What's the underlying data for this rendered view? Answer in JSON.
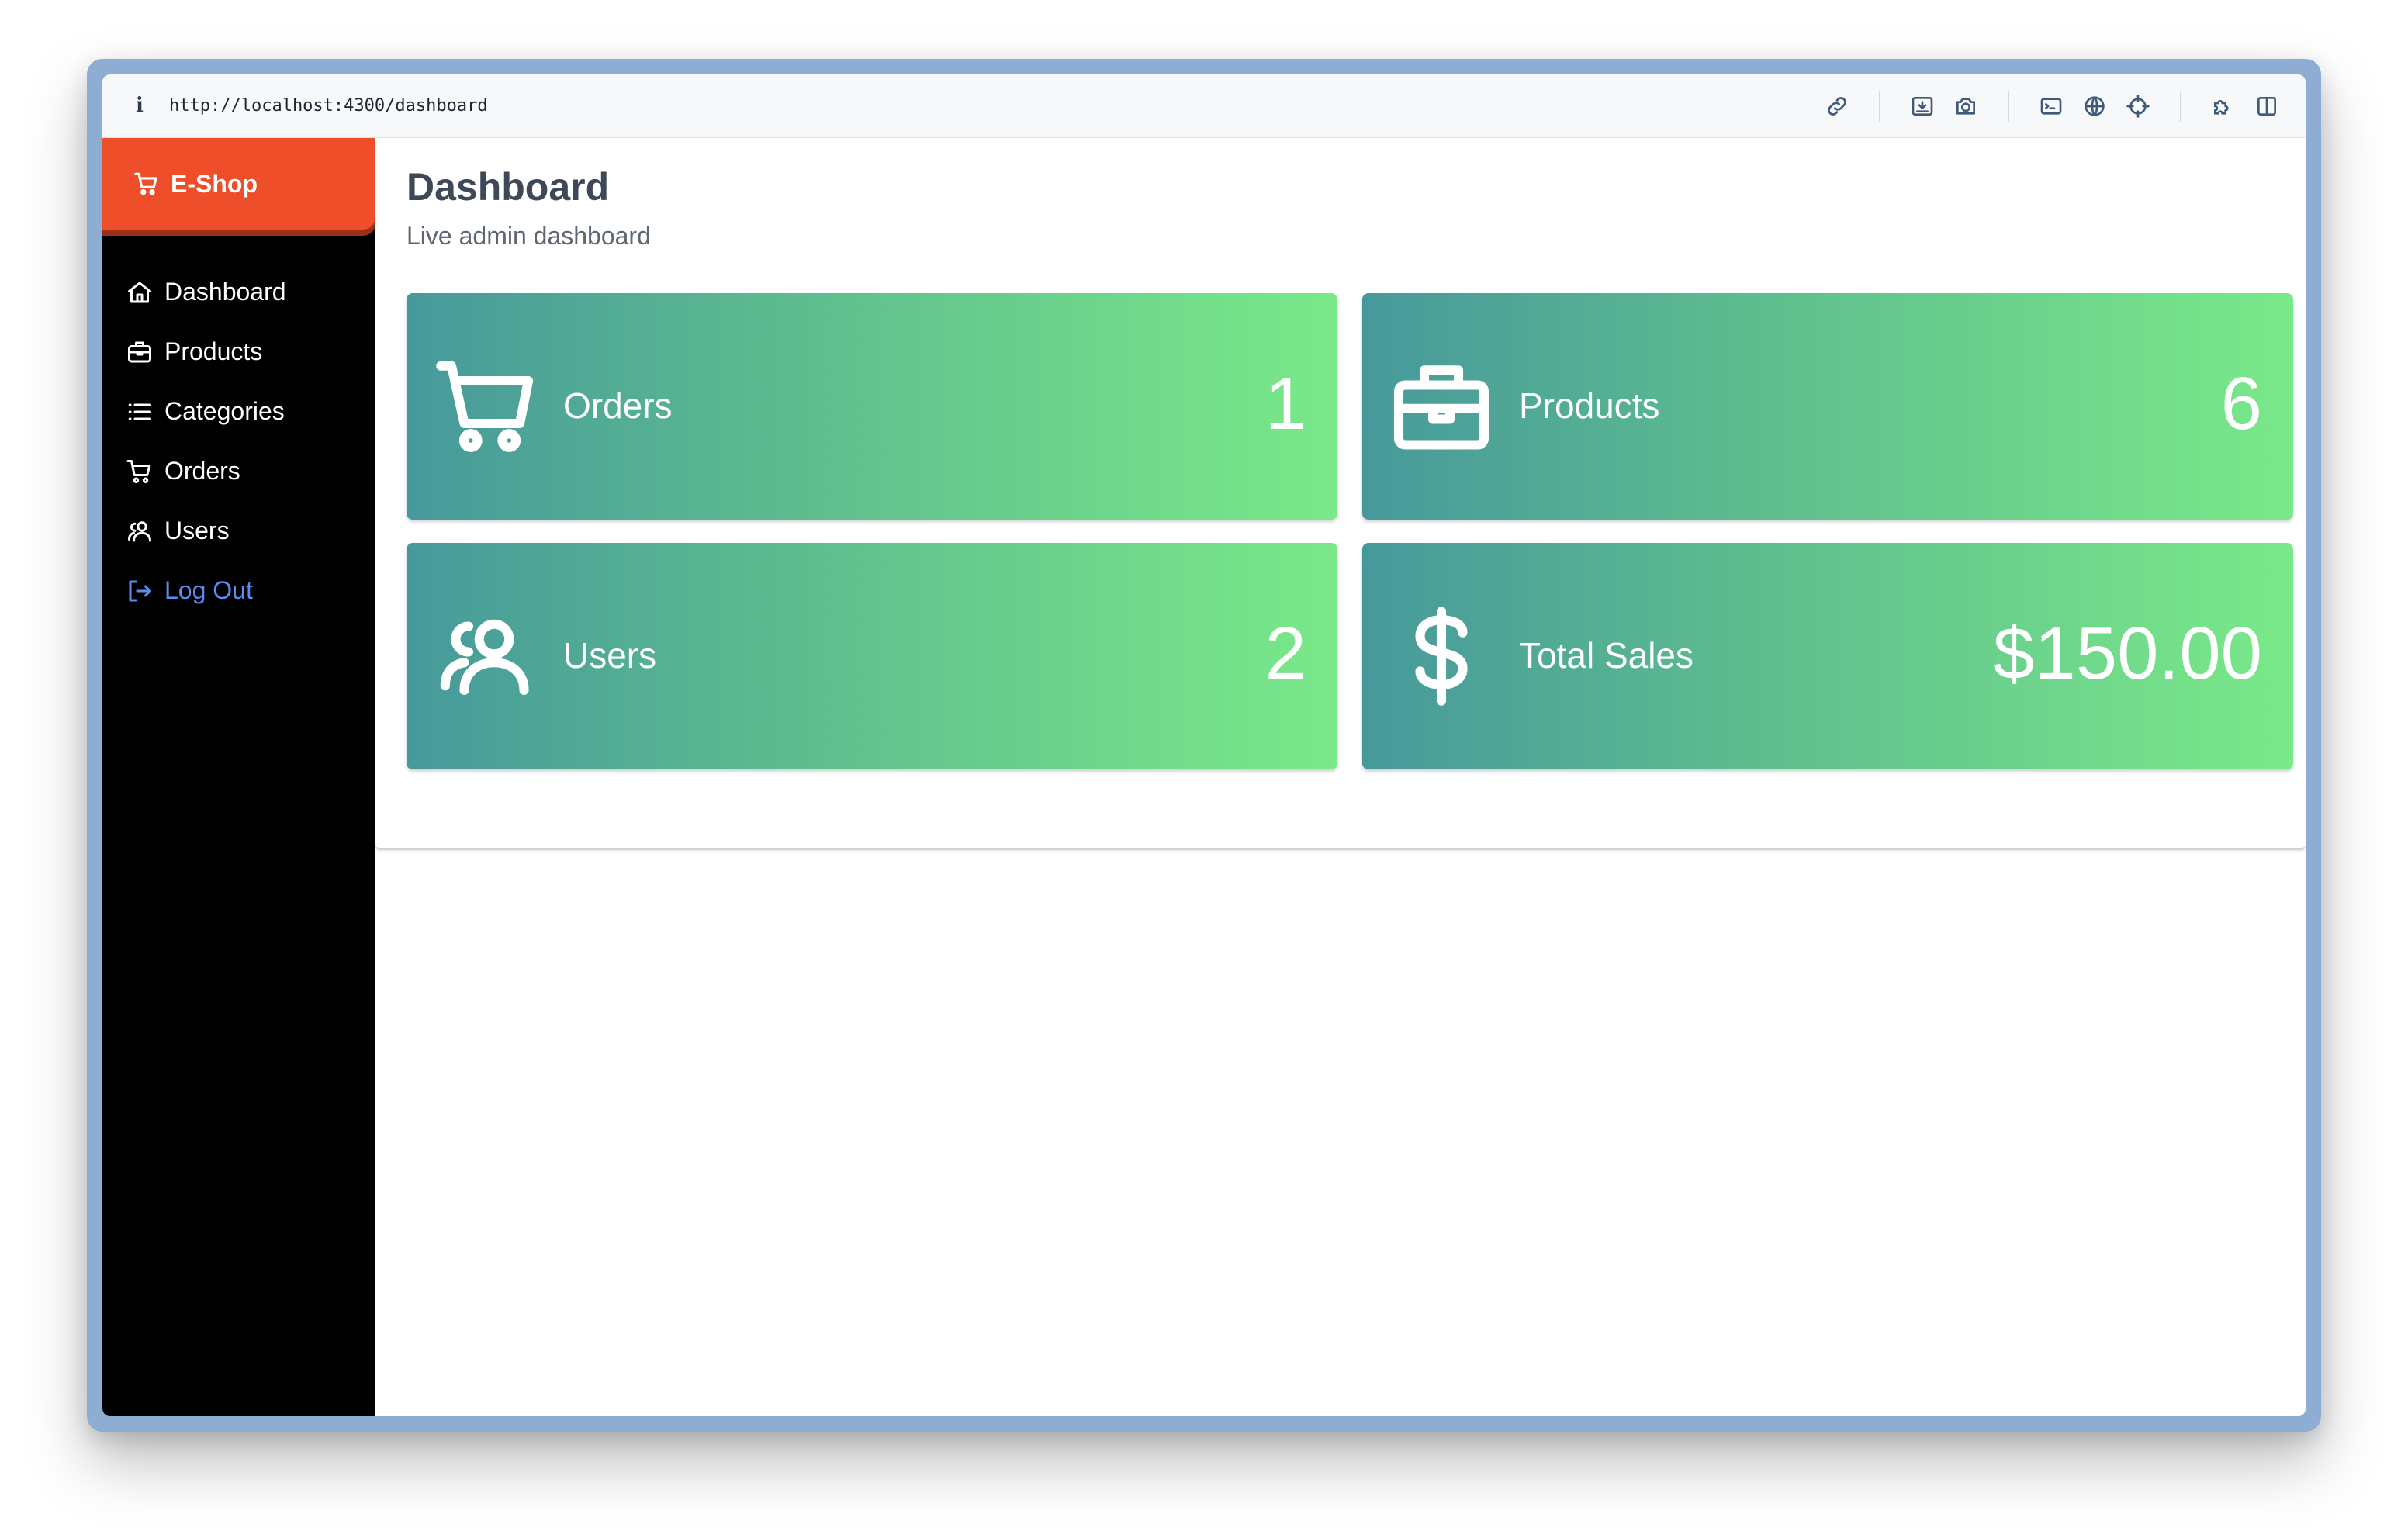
{
  "browser": {
    "info_icon": "i",
    "url": "http://localhost:4300/dashboard",
    "toolbar_icons": [
      "link-icon",
      "download-icon",
      "camera-icon",
      "terminal-icon",
      "globe-icon",
      "crosshair-icon",
      "extension-icon",
      "split-view-icon"
    ]
  },
  "sidebar": {
    "brand": {
      "label": "E-Shop",
      "icon": "cart-icon",
      "color": "#ef4e2b"
    },
    "items": [
      {
        "label": "Dashboard",
        "icon": "home-icon"
      },
      {
        "label": "Products",
        "icon": "briefcase-icon"
      },
      {
        "label": "Categories",
        "icon": "list-icon"
      },
      {
        "label": "Orders",
        "icon": "cart-icon"
      },
      {
        "label": "Users",
        "icon": "users-icon"
      },
      {
        "label": "Log Out",
        "icon": "logout-icon",
        "color": "#5b8cf0"
      }
    ]
  },
  "main": {
    "title": "Dashboard",
    "subtitle": "Live admin dashboard",
    "cards": [
      {
        "label": "Orders",
        "value": "1",
        "icon": "cart-icon"
      },
      {
        "label": "Products",
        "value": "6",
        "icon": "briefcase-icon"
      },
      {
        "label": "Users",
        "value": "2",
        "icon": "users-icon"
      },
      {
        "label": "Total Sales",
        "value": "$150.00",
        "icon": "dollar-icon"
      }
    ],
    "card_gradient": [
      "#46999b",
      "#7ae989"
    ]
  }
}
